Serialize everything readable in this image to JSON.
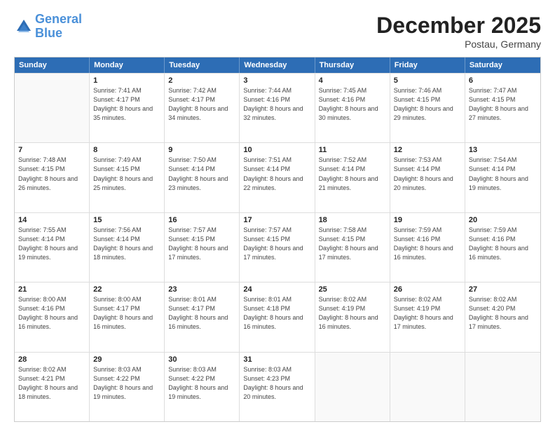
{
  "header": {
    "logo_line1": "General",
    "logo_line2": "Blue",
    "month": "December 2025",
    "location": "Postau, Germany"
  },
  "days_of_week": [
    "Sunday",
    "Monday",
    "Tuesday",
    "Wednesday",
    "Thursday",
    "Friday",
    "Saturday"
  ],
  "weeks": [
    [
      {
        "day": "",
        "empty": true
      },
      {
        "day": "1",
        "info": "Sunrise: 7:41 AM\nSunset: 4:17 PM\nDaylight: 8 hours\nand 35 minutes."
      },
      {
        "day": "2",
        "info": "Sunrise: 7:42 AM\nSunset: 4:17 PM\nDaylight: 8 hours\nand 34 minutes."
      },
      {
        "day": "3",
        "info": "Sunrise: 7:44 AM\nSunset: 4:16 PM\nDaylight: 8 hours\nand 32 minutes."
      },
      {
        "day": "4",
        "info": "Sunrise: 7:45 AM\nSunset: 4:16 PM\nDaylight: 8 hours\nand 30 minutes."
      },
      {
        "day": "5",
        "info": "Sunrise: 7:46 AM\nSunset: 4:15 PM\nDaylight: 8 hours\nand 29 minutes."
      },
      {
        "day": "6",
        "info": "Sunrise: 7:47 AM\nSunset: 4:15 PM\nDaylight: 8 hours\nand 27 minutes."
      }
    ],
    [
      {
        "day": "7",
        "info": "Sunrise: 7:48 AM\nSunset: 4:15 PM\nDaylight: 8 hours\nand 26 minutes."
      },
      {
        "day": "8",
        "info": "Sunrise: 7:49 AM\nSunset: 4:15 PM\nDaylight: 8 hours\nand 25 minutes."
      },
      {
        "day": "9",
        "info": "Sunrise: 7:50 AM\nSunset: 4:14 PM\nDaylight: 8 hours\nand 23 minutes."
      },
      {
        "day": "10",
        "info": "Sunrise: 7:51 AM\nSunset: 4:14 PM\nDaylight: 8 hours\nand 22 minutes."
      },
      {
        "day": "11",
        "info": "Sunrise: 7:52 AM\nSunset: 4:14 PM\nDaylight: 8 hours\nand 21 minutes."
      },
      {
        "day": "12",
        "info": "Sunrise: 7:53 AM\nSunset: 4:14 PM\nDaylight: 8 hours\nand 20 minutes."
      },
      {
        "day": "13",
        "info": "Sunrise: 7:54 AM\nSunset: 4:14 PM\nDaylight: 8 hours\nand 19 minutes."
      }
    ],
    [
      {
        "day": "14",
        "info": "Sunrise: 7:55 AM\nSunset: 4:14 PM\nDaylight: 8 hours\nand 19 minutes."
      },
      {
        "day": "15",
        "info": "Sunrise: 7:56 AM\nSunset: 4:14 PM\nDaylight: 8 hours\nand 18 minutes."
      },
      {
        "day": "16",
        "info": "Sunrise: 7:57 AM\nSunset: 4:15 PM\nDaylight: 8 hours\nand 17 minutes."
      },
      {
        "day": "17",
        "info": "Sunrise: 7:57 AM\nSunset: 4:15 PM\nDaylight: 8 hours\nand 17 minutes."
      },
      {
        "day": "18",
        "info": "Sunrise: 7:58 AM\nSunset: 4:15 PM\nDaylight: 8 hours\nand 17 minutes."
      },
      {
        "day": "19",
        "info": "Sunrise: 7:59 AM\nSunset: 4:16 PM\nDaylight: 8 hours\nand 16 minutes."
      },
      {
        "day": "20",
        "info": "Sunrise: 7:59 AM\nSunset: 4:16 PM\nDaylight: 8 hours\nand 16 minutes."
      }
    ],
    [
      {
        "day": "21",
        "info": "Sunrise: 8:00 AM\nSunset: 4:16 PM\nDaylight: 8 hours\nand 16 minutes."
      },
      {
        "day": "22",
        "info": "Sunrise: 8:00 AM\nSunset: 4:17 PM\nDaylight: 8 hours\nand 16 minutes."
      },
      {
        "day": "23",
        "info": "Sunrise: 8:01 AM\nSunset: 4:17 PM\nDaylight: 8 hours\nand 16 minutes."
      },
      {
        "day": "24",
        "info": "Sunrise: 8:01 AM\nSunset: 4:18 PM\nDaylight: 8 hours\nand 16 minutes."
      },
      {
        "day": "25",
        "info": "Sunrise: 8:02 AM\nSunset: 4:19 PM\nDaylight: 8 hours\nand 16 minutes."
      },
      {
        "day": "26",
        "info": "Sunrise: 8:02 AM\nSunset: 4:19 PM\nDaylight: 8 hours\nand 17 minutes."
      },
      {
        "day": "27",
        "info": "Sunrise: 8:02 AM\nSunset: 4:20 PM\nDaylight: 8 hours\nand 17 minutes."
      }
    ],
    [
      {
        "day": "28",
        "info": "Sunrise: 8:02 AM\nSunset: 4:21 PM\nDaylight: 8 hours\nand 18 minutes."
      },
      {
        "day": "29",
        "info": "Sunrise: 8:03 AM\nSunset: 4:22 PM\nDaylight: 8 hours\nand 19 minutes."
      },
      {
        "day": "30",
        "info": "Sunrise: 8:03 AM\nSunset: 4:22 PM\nDaylight: 8 hours\nand 19 minutes."
      },
      {
        "day": "31",
        "info": "Sunrise: 8:03 AM\nSunset: 4:23 PM\nDaylight: 8 hours\nand 20 minutes."
      },
      {
        "day": "",
        "empty": true
      },
      {
        "day": "",
        "empty": true
      },
      {
        "day": "",
        "empty": true
      }
    ]
  ]
}
